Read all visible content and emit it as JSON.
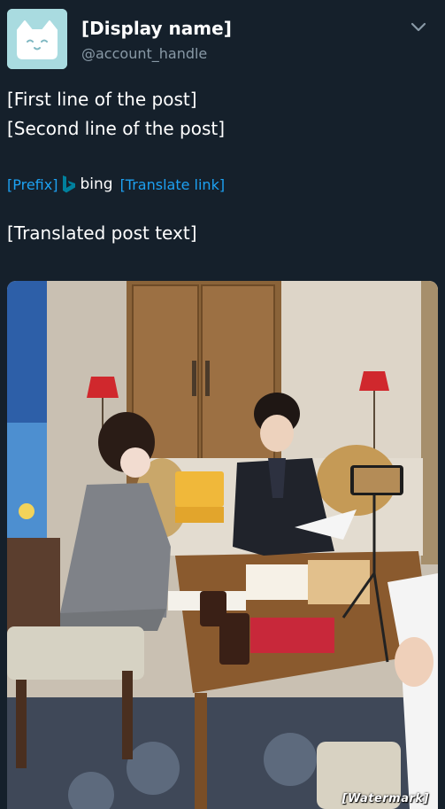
{
  "user": {
    "display_name": "[Display name]",
    "handle": "@account_handle",
    "avatar_icon": "cat-face-icon"
  },
  "tweet": {
    "text_lines": [
      "[First line of the post]",
      "[Second line of the post]"
    ]
  },
  "translation": {
    "prefix": "[Prefix]",
    "provider": "bing",
    "suffix": "[Translate link]"
  },
  "translated_text": "[Translated post text]",
  "photo": {
    "description_icon": "interview-photo",
    "watermark": "[Watermark]"
  },
  "colors": {
    "background": "#15202b",
    "link": "#1da1f2",
    "secondary_text": "#8899a6",
    "bing_teal": "#00809d"
  }
}
